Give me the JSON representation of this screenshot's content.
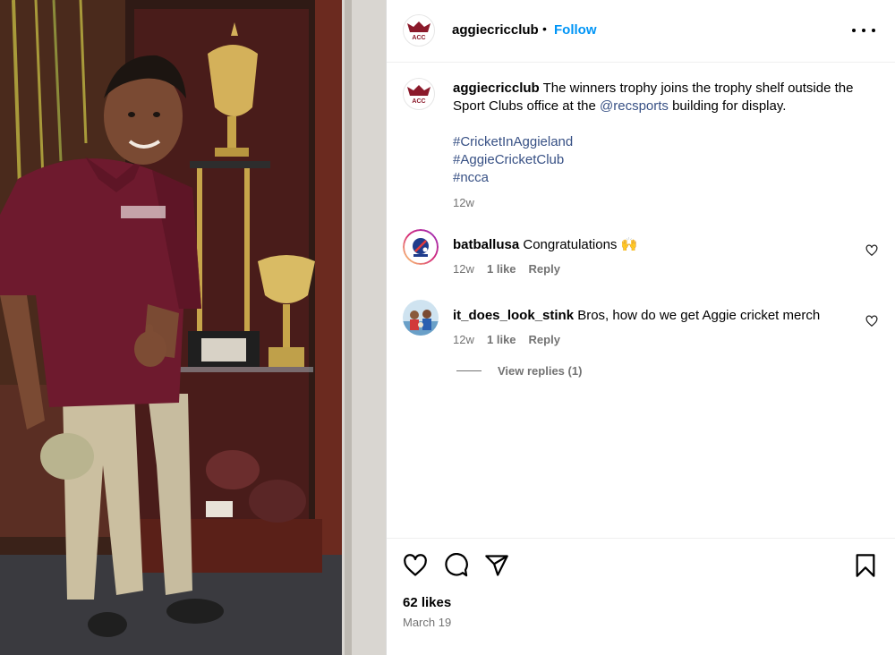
{
  "post": {
    "username": "aggiecricclub",
    "follow_label": "Follow",
    "caption_text": "The winners trophy joins the trophy shelf outside the Sport Clubs office at the",
    "caption_mention": "@recsports",
    "caption_tail": "building for display.",
    "hashtags": [
      "#CricketInAggieland",
      "#AggieCricketClub",
      "#ncca"
    ],
    "caption_time": "12w",
    "likes_count": "62 likes",
    "date": "March 19"
  },
  "avatar_logo_text": "ACC",
  "comments": [
    {
      "username": "batballusa",
      "text": "Congratulations 🙌",
      "time": "12w",
      "likes": "1 like",
      "reply_label": "Reply"
    },
    {
      "username": "it_does_look_stink",
      "text": "Bros, how do we get Aggie cricket merch",
      "time": "12w",
      "likes": "1 like",
      "reply_label": "Reply"
    }
  ],
  "view_replies_label": "View replies (1)",
  "icons": {
    "more": "more-options-icon",
    "like": "heart-icon",
    "comment": "comment-icon",
    "share": "share-icon",
    "save": "bookmark-icon",
    "comment_like": "small-heart-icon"
  },
  "colors": {
    "link_blue": "#0095f6",
    "mention_blue": "#385185",
    "secondary_gray": "#737373",
    "brand_maroon": "#8b1a2b"
  }
}
